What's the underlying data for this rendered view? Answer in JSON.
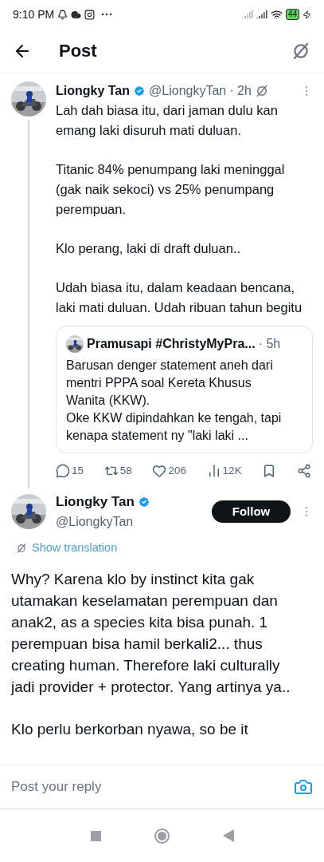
{
  "status_bar": {
    "time": "9:10 PM",
    "battery": "44"
  },
  "header": {
    "title": "Post"
  },
  "reply_tweet": {
    "name": "Liongky Tan",
    "handle": "@LiongkyTan",
    "time": "· 2h",
    "verified": true,
    "paragraphs": [
      "Lah dah biasa itu, dari jaman dulu kan emang laki disuruh mati duluan.",
      "Titanic 84% penumpang laki meninggal (gak naik sekoci) vs 25% penumpang perempuan.",
      "Klo perang, laki di draft duluan..",
      "Udah biasa itu, dalam keadaan bencana, laki mati duluan. Udah ribuan tahun begitu"
    ],
    "quote": {
      "name": "Pramusapi #ChristyMyPra...",
      "time": "· 5h",
      "text": "Barusan denger statement aneh dari mentri PPPA soal Kereta Khusus Wanita (KKW).\nOke KKW dipindahkan ke tengah, tapi kenapa statement ny \"laki laki ..."
    },
    "actions": [
      {
        "kind": "reply",
        "count": "15"
      },
      {
        "kind": "repost",
        "count": "58"
      },
      {
        "kind": "like",
        "count": "206"
      },
      {
        "kind": "views",
        "count": "12K"
      },
      {
        "kind": "bookmark"
      },
      {
        "kind": "share"
      }
    ]
  },
  "main_tweet": {
    "name": "Liongky Tan",
    "handle": "@LiongkyTan",
    "verified": true,
    "follow_button": "Follow",
    "translation_link": "Show translation",
    "paragraphs": [
      "Why? Karena klo by instinct kita gak utamakan keselamatan perempuan dan anak2, as a species kita bisa punah. 1 perempuan bisa hamil berkali2... thus creating human. Therefore laki culturally jadi provider + protector. Yang artinya ya..",
      "Klo perlu berkorban nyawa, so be it"
    ]
  },
  "reply_bar": {
    "placeholder": "Post your reply"
  }
}
